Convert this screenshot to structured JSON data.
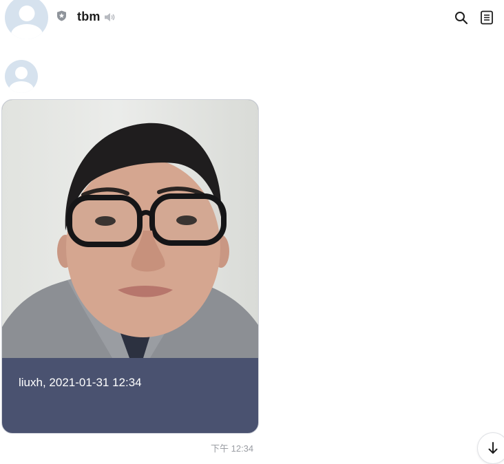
{
  "header": {
    "title": "tbm",
    "icons": [
      "shield-icon",
      "mute-icon",
      "search-icon",
      "notes-icon"
    ]
  },
  "message": {
    "caption": "liuxh, 2021-01-31 12:34",
    "time": "下午 12:34"
  },
  "colors": {
    "card_footer": "#4a5270",
    "avatar_bg": "#d6e2ee",
    "timestamp": "#9a9da3"
  }
}
